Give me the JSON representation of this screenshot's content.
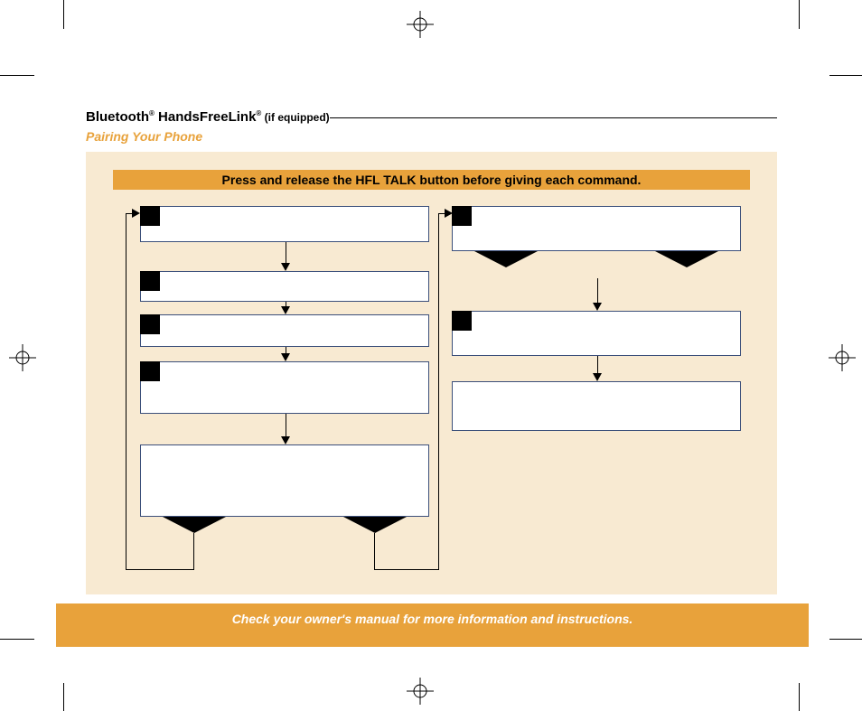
{
  "header": {
    "title_prefix": "Bluetooth",
    "title_mid": " HandsFreeLink",
    "title_suffix": " (if equipped)",
    "subtitle": "Pairing Your Phone"
  },
  "banner": "Press and release the HFL TALK button before giving each command.",
  "footer": "Check your owner's manual for more information and instructions."
}
